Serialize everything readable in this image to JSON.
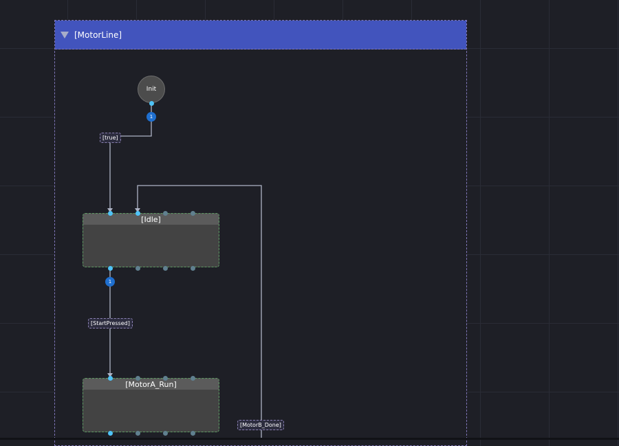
{
  "group": {
    "title": "[MotorLine]"
  },
  "init": {
    "label": "Init"
  },
  "states": {
    "idle": {
      "label": "[Idle]"
    },
    "motor_a_run": {
      "label": "[MotorA_Run]"
    }
  },
  "transitions": {
    "init_to_idle": {
      "condition": "[true]",
      "priority": "1"
    },
    "idle_to_motor_a": {
      "condition": "[StartPressed]",
      "priority": "1"
    },
    "motor_b_to_idle": {
      "condition": "[MotorB_Done]"
    }
  },
  "colors": {
    "background": "#1e1f26",
    "group_header": "#4254bd",
    "state_border": "#5d9b63",
    "wire": "#aeb4c6",
    "active_port": "#4fc3f7",
    "badge": "#1f6fcf"
  }
}
